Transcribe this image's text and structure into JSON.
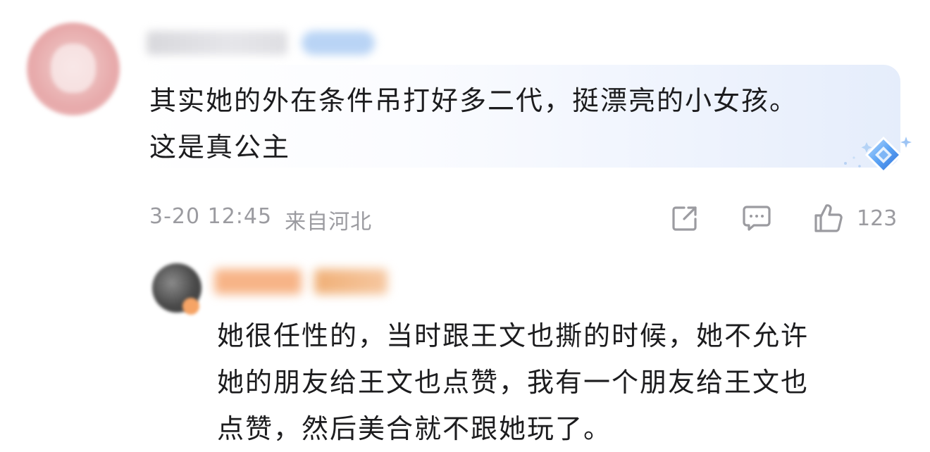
{
  "comment": {
    "text": "其实她的外在条件吊打好多二代，挺漂亮的小女孩。\n这是真公主",
    "date": "3-20 12:45",
    "location": "来自河北",
    "actions": {
      "share_icon": "share-icon",
      "comment_icon": "comment-icon",
      "like_icon": "thumbs-up-icon",
      "like_count": "123"
    }
  },
  "reply": {
    "text": "她很任性的，当时跟王文也撕的时候，她不允许\n她的朋友给王文也点赞，我有一个朋友给王文也\n点赞，然后美合就不跟她玩了。"
  },
  "colors": {
    "text": "#1c1c1e",
    "meta": "#9b9ba0",
    "bubble_accent": "#e5edfb",
    "badge_blue": "#4a8ff0"
  }
}
